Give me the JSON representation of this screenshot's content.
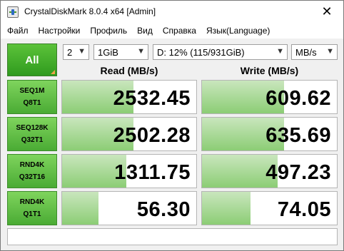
{
  "window": {
    "title": "CrystalDiskMark 8.0.4 x64 [Admin]",
    "close_label": "✕"
  },
  "menu": [
    "Файл",
    "Настройки",
    "Профиль",
    "Вид",
    "Справка",
    "Язык(Language)"
  ],
  "controls": {
    "all_label": "All",
    "count": "2",
    "size": "1GiB",
    "drive": "D: 12% (115/931GiB)",
    "unit": "MB/s"
  },
  "headers": {
    "read": "Read (MB/s)",
    "write": "Write (MB/s)"
  },
  "tests": [
    {
      "line1": "SEQ1M",
      "line2": "Q8T1",
      "read": "2532.45",
      "write": "609.62",
      "read_fill": 0.53,
      "write_fill": 0.61
    },
    {
      "line1": "SEQ128K",
      "line2": "Q32T1",
      "read": "2502.28",
      "write": "635.69",
      "read_fill": 0.53,
      "write_fill": 0.61
    },
    {
      "line1": "RND4K",
      "line2": "Q32T16",
      "read": "1311.75",
      "write": "497.23",
      "read_fill": 0.48,
      "write_fill": 0.56
    },
    {
      "line1": "RND4K",
      "line2": "Q1T1",
      "read": "56.30",
      "write": "74.05",
      "read_fill": 0.27,
      "write_fill": 0.36
    }
  ],
  "status_text": ""
}
